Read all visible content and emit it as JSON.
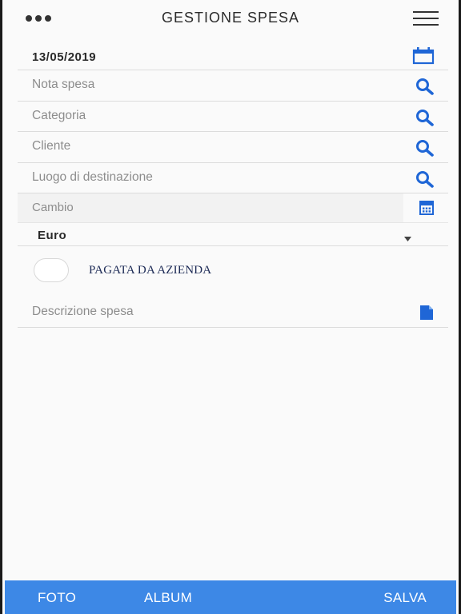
{
  "header": {
    "title": "GESTIONE SPESA"
  },
  "form": {
    "date_value": "13/05/2019",
    "nota_spesa_placeholder": "Nota spesa",
    "categoria_placeholder": "Categoria",
    "cliente_placeholder": "Cliente",
    "luogo_placeholder": "Luogo di destinazione",
    "cambio_placeholder": "Cambio",
    "currency_selected": "Euro",
    "pagata_label": "PAGATA DA AZIENDA",
    "pagata_checked": false,
    "descrizione_placeholder": "Descrizione spesa"
  },
  "toolbar": {
    "foto_label": "FOTO",
    "album_label": "ALBUM",
    "salva_label": "SALVA"
  },
  "icons": {
    "menu_left": "more-dots-icon",
    "menu_right": "hamburger-menu-icon",
    "date": "calendar-icon",
    "search": "search-icon",
    "calculator": "calculator-icon",
    "dropdown": "caret-down-icon",
    "document": "document-icon"
  },
  "colors": {
    "accent": "#1f66d6",
    "bottom_bar": "#3d88e6",
    "text_dark": "#2a2a2a",
    "placeholder": "#8d8d8d"
  }
}
